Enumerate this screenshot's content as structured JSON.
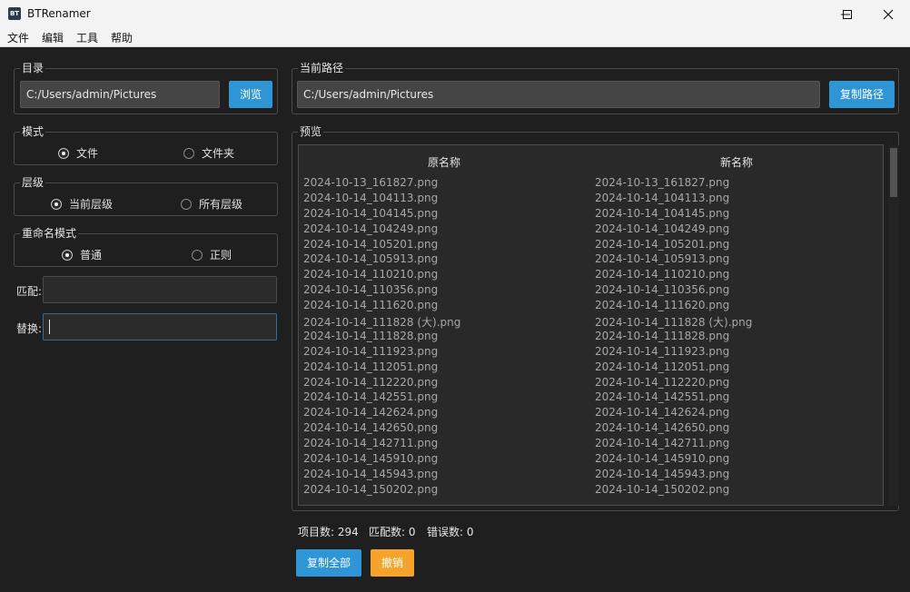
{
  "window": {
    "title": "BTRenamer",
    "icon_text": "BT",
    "controls": [
      "minimize-icon",
      "maximize-icon",
      "close-icon"
    ]
  },
  "menu": [
    "文件",
    "编辑",
    "工具",
    "帮助"
  ],
  "directory": {
    "legend": "目录",
    "path": "C:/Users/admin/Pictures",
    "browse_label": "浏览"
  },
  "current_path": {
    "legend": "当前路径",
    "path": "C:/Users/admin/Pictures",
    "copy_label": "复制路径"
  },
  "mode": {
    "legend": "模式",
    "options": [
      "文件",
      "文件夹"
    ],
    "selected": "文件"
  },
  "level": {
    "legend": "层级",
    "options": [
      "当前层级",
      "所有层级"
    ],
    "selected": "当前层级"
  },
  "rename_mode": {
    "legend": "重命名模式",
    "options": [
      "普通",
      "正则"
    ],
    "selected": "普通"
  },
  "match": {
    "label": "匹配:",
    "value": ""
  },
  "replace": {
    "label": "替换:",
    "value": ""
  },
  "preview": {
    "legend": "预览",
    "columns": [
      "原名称",
      "新名称"
    ],
    "rows": [
      [
        "2024-10-13_161827.png",
        "2024-10-13_161827.png"
      ],
      [
        "2024-10-14_104113.png",
        "2024-10-14_104113.png"
      ],
      [
        "2024-10-14_104145.png",
        "2024-10-14_104145.png"
      ],
      [
        "2024-10-14_104249.png",
        "2024-10-14_104249.png"
      ],
      [
        "2024-10-14_105201.png",
        "2024-10-14_105201.png"
      ],
      [
        "2024-10-14_105913.png",
        "2024-10-14_105913.png"
      ],
      [
        "2024-10-14_110210.png",
        "2024-10-14_110210.png"
      ],
      [
        "2024-10-14_110356.png",
        "2024-10-14_110356.png"
      ],
      [
        "2024-10-14_111620.png",
        "2024-10-14_111620.png"
      ],
      [
        "2024-10-14_111828 (大).png",
        "2024-10-14_111828 (大).png"
      ],
      [
        "2024-10-14_111828.png",
        "2024-10-14_111828.png"
      ],
      [
        "2024-10-14_111923.png",
        "2024-10-14_111923.png"
      ],
      [
        "2024-10-14_112051.png",
        "2024-10-14_112051.png"
      ],
      [
        "2024-10-14_112220.png",
        "2024-10-14_112220.png"
      ],
      [
        "2024-10-14_142551.png",
        "2024-10-14_142551.png"
      ],
      [
        "2024-10-14_142624.png",
        "2024-10-14_142624.png"
      ],
      [
        "2024-10-14_142650.png",
        "2024-10-14_142650.png"
      ],
      [
        "2024-10-14_142711.png",
        "2024-10-14_142711.png"
      ],
      [
        "2024-10-14_145910.png",
        "2024-10-14_145910.png"
      ],
      [
        "2024-10-14_145943.png",
        "2024-10-14_145943.png"
      ],
      [
        "2024-10-14_150202.png",
        "2024-10-14_150202.png"
      ]
    ]
  },
  "status": {
    "items_label": "项目数: 294",
    "matches_label": "匹配数: 0",
    "errors_label": "错误数: 0"
  },
  "actions": {
    "copy_all_label": "复制全部",
    "undo_label": "撤销"
  },
  "colors": {
    "accent_blue": "#2e96d6",
    "accent_orange": "#f5a32a",
    "background": "#1f1f1f"
  }
}
